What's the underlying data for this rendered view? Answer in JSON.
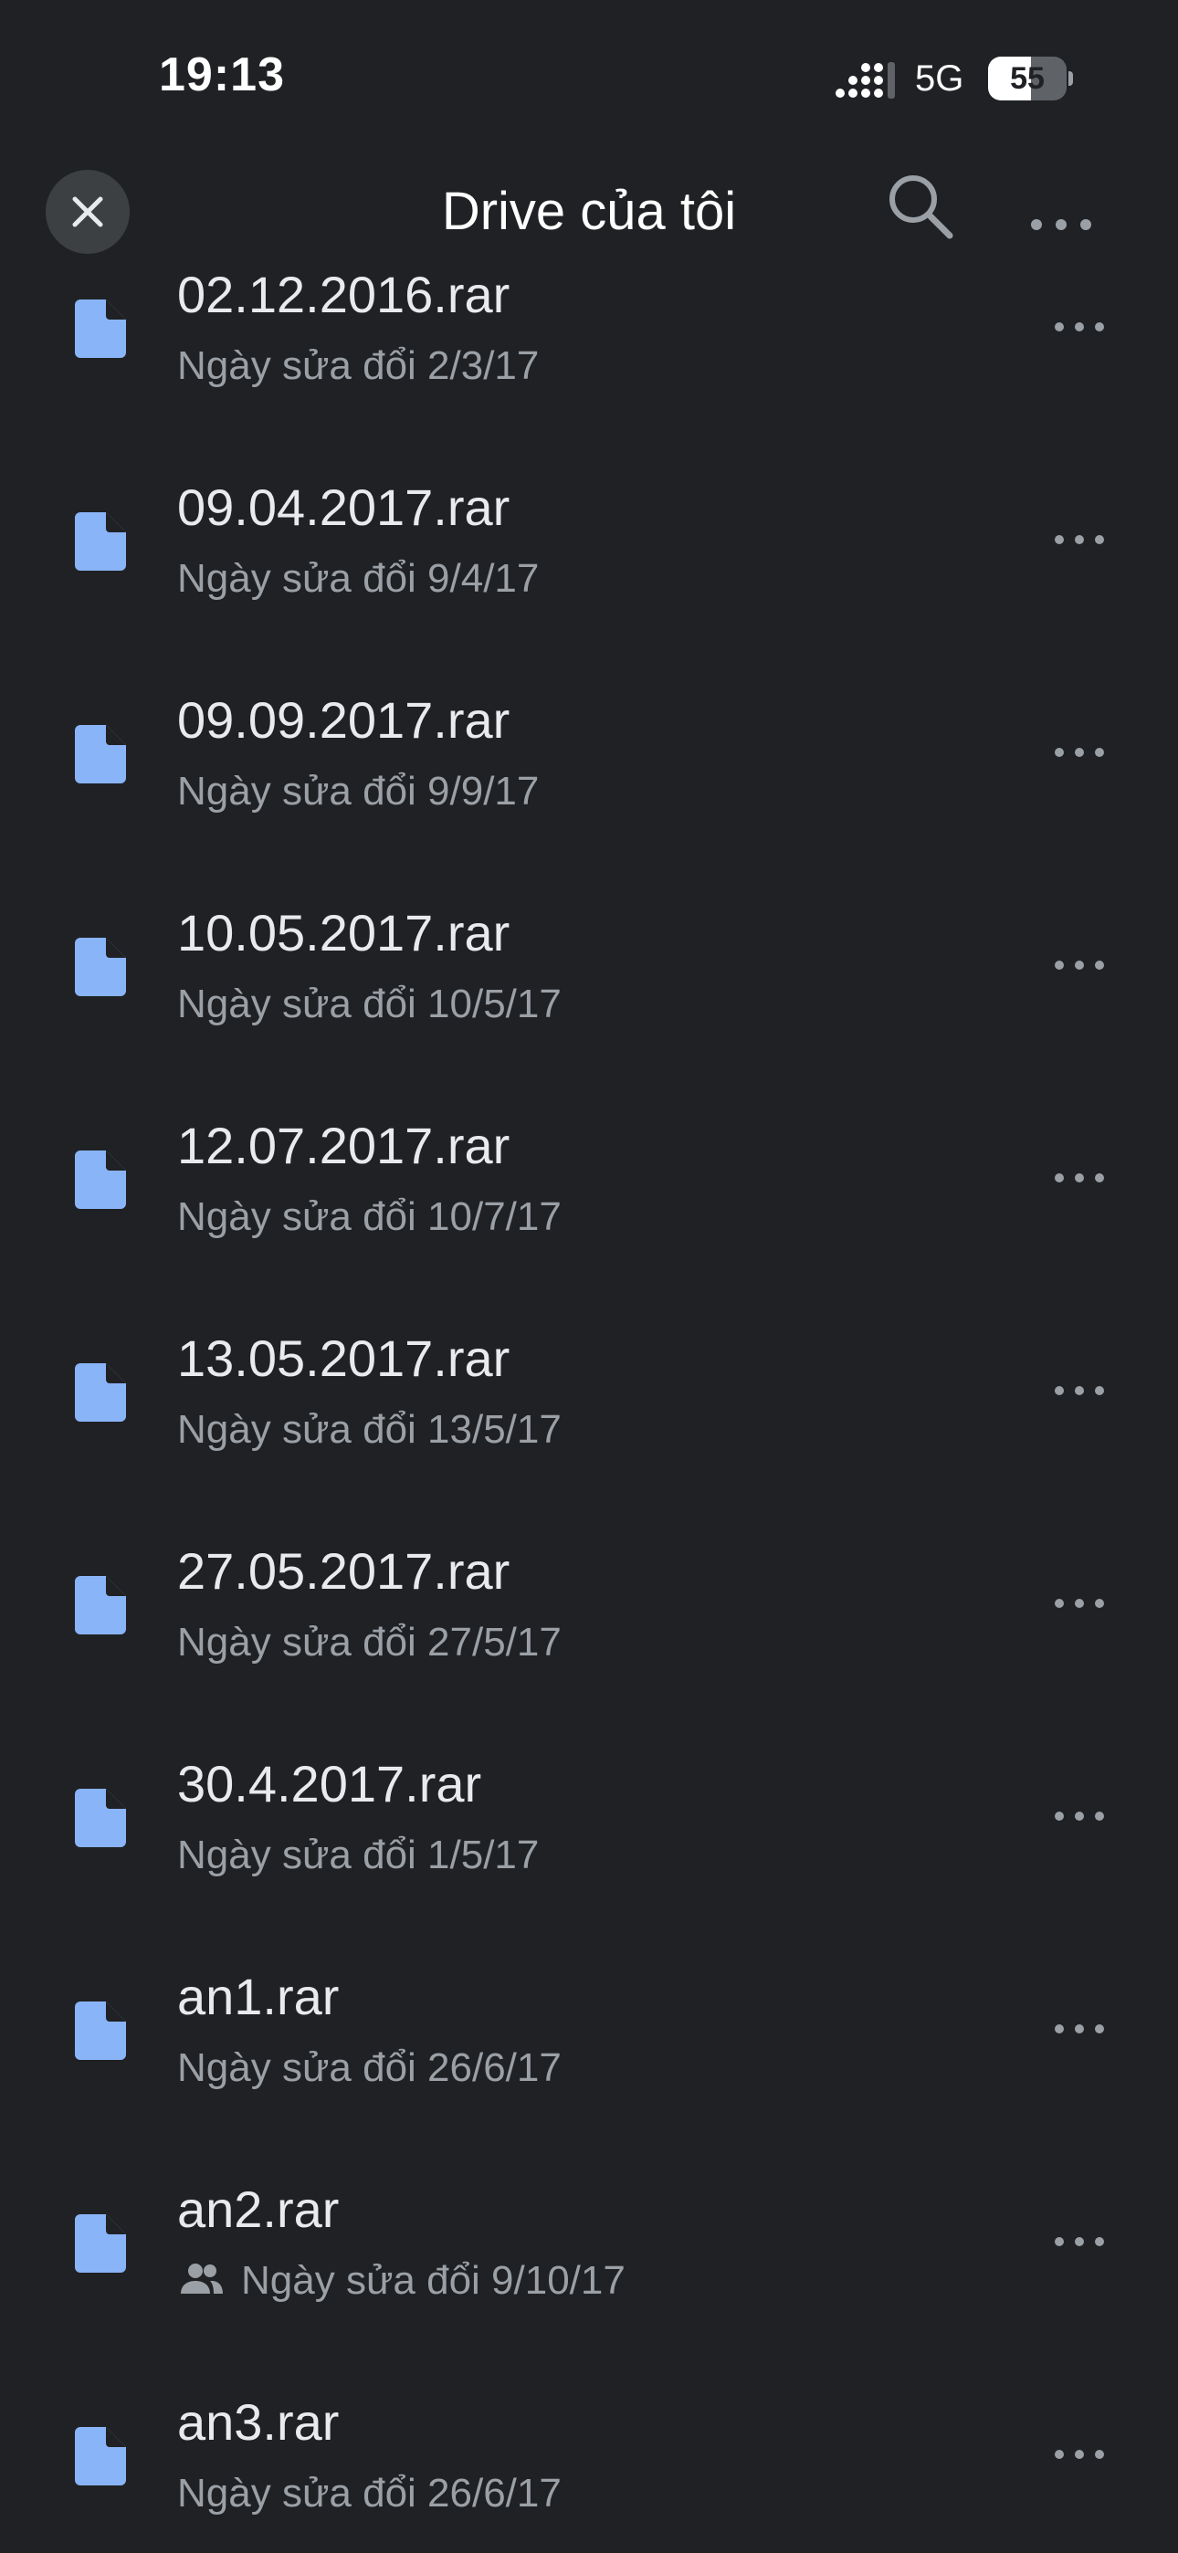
{
  "status_bar": {
    "time": "19:13",
    "network": "5G",
    "battery_level": "55",
    "battery_fraction": 0.55
  },
  "app_bar": {
    "title": "Drive của tôi",
    "close_icon": "close-icon",
    "search_icon": "search-icon",
    "more_icon": "more-horizontal-icon"
  },
  "files": [
    {
      "name": "02.12.2016.rar",
      "meta": "Ngày sửa đổi 2/3/17",
      "shared": false
    },
    {
      "name": "09.04.2017.rar",
      "meta": "Ngày sửa đổi 9/4/17",
      "shared": false
    },
    {
      "name": "09.09.2017.rar",
      "meta": "Ngày sửa đổi 9/9/17",
      "shared": false
    },
    {
      "name": "10.05.2017.rar",
      "meta": "Ngày sửa đổi 10/5/17",
      "shared": false
    },
    {
      "name": "12.07.2017.rar",
      "meta": "Ngày sửa đổi 10/7/17",
      "shared": false
    },
    {
      "name": "13.05.2017.rar",
      "meta": "Ngày sửa đổi 13/5/17",
      "shared": false
    },
    {
      "name": "27.05.2017.rar",
      "meta": "Ngày sửa đổi 27/5/17",
      "shared": false
    },
    {
      "name": "30.4.2017.rar",
      "meta": "Ngày sửa đổi 1/5/17",
      "shared": false
    },
    {
      "name": "an1.rar",
      "meta": "Ngày sửa đổi 26/6/17",
      "shared": false
    },
    {
      "name": "an2.rar",
      "meta": "Ngày sửa đổi 9/10/17",
      "shared": true
    },
    {
      "name": "an3.rar",
      "meta": "Ngày sửa đổi 26/6/17",
      "shared": false
    }
  ],
  "colors": {
    "background": "#202124",
    "file_icon": "#8ab4f8",
    "primary_text": "#e8eaed",
    "secondary_text": "#9aa0a6"
  }
}
